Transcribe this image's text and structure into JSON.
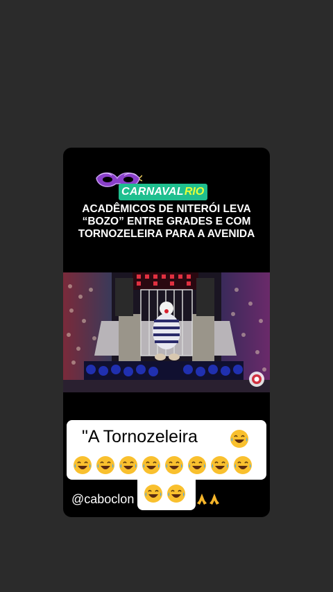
{
  "post": {
    "logo": {
      "part1": "CARNAVAL",
      "part2": "RIO"
    },
    "headline": [
      "ACADÊMICOS DE NITERÓI LEVA",
      "“BOZO” ENTRE GRADES E COM",
      "TORNOZELEIRA PARA A AVENIDA"
    ],
    "image_description": "Desfile de carnaval: figura fantasiada de palhaço com uniforme listrado dentro de uma jaula em carro alegórico"
  },
  "caption": {
    "text": "\"A Tornozeleira",
    "emoji_line1_icon": "laughing-crying-emoji",
    "emoji_line2_count": 8,
    "emoji_line3_count": 2
  },
  "mention": {
    "handle": "@caboclon",
    "trailing_icons": [
      "folded-hands-emoji",
      "folded-hands-emoji"
    ]
  },
  "colors": {
    "background": "#2b2b2b",
    "card": "#000000",
    "logo_bg": "#1fbf8f",
    "logo_accent": "#e6ff3a"
  }
}
